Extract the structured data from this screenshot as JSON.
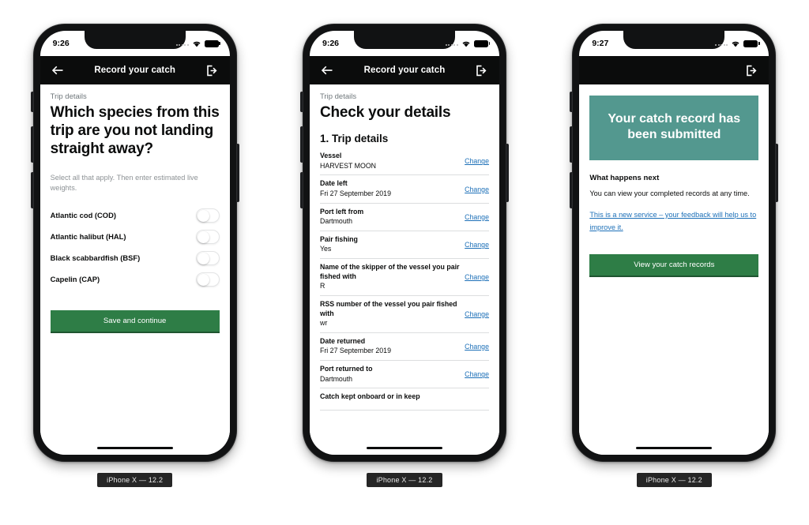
{
  "devices": [
    {
      "chip_label": "iPhone X — 12.2",
      "status": {
        "time": "9:26",
        "wifi_icon": "wifi-icon",
        "battery_icon": "battery-icon",
        "signal_icon": "signal-dots-icon"
      },
      "appbar": {
        "back_icon": "back-arrow-icon",
        "title": "Record your catch",
        "exit_icon": "sign-out-icon",
        "has_back": true,
        "has_title": true
      }
    },
    {
      "chip_label": "iPhone X — 12.2",
      "status": {
        "time": "9:26",
        "wifi_icon": "wifi-icon",
        "battery_icon": "battery-icon",
        "signal_icon": "signal-dots-icon"
      },
      "appbar": {
        "back_icon": "back-arrow-icon",
        "title": "Record your catch",
        "exit_icon": "sign-out-icon",
        "has_back": true,
        "has_title": true
      }
    },
    {
      "chip_label": "iPhone X — 12.2",
      "status": {
        "time": "9:27",
        "wifi_icon": "wifi-icon",
        "battery_icon": "battery-icon",
        "signal_icon": "signal-dots-icon"
      },
      "appbar": {
        "back_icon": "",
        "title": "",
        "exit_icon": "sign-out-icon",
        "has_back": false,
        "has_title": false
      }
    }
  ],
  "screen1": {
    "caption": "Trip details",
    "heading": "Which species from this trip are you not landing straight away?",
    "hint": "Select all that apply. Then enter estimated live weights.",
    "species": [
      {
        "label": "Atlantic cod (COD)",
        "state": "off"
      },
      {
        "label": "Atlantic halibut (HAL)",
        "state": "off"
      },
      {
        "label": "Black scabbardfish (BSF)",
        "state": "off"
      },
      {
        "label": "Capelin (CAP)",
        "state": "off"
      }
    ],
    "primary_button": "Save and continue"
  },
  "screen2": {
    "caption": "Trip details",
    "heading": "Check your details",
    "section_title": "1. Trip details",
    "change_label": "Change",
    "rows": [
      {
        "key": "Vessel",
        "value": "HARVEST MOON"
      },
      {
        "key": "Date left",
        "value": "Fri 27 September 2019"
      },
      {
        "key": "Port left from",
        "value": "Dartmouth"
      },
      {
        "key": "Pair fishing",
        "value": "Yes"
      },
      {
        "key": "Name of the skipper of the vessel you pair fished with",
        "value": "R"
      },
      {
        "key": "RSS number of the vessel you pair fished with",
        "value": "wr"
      },
      {
        "key": "Date returned",
        "value": "Fri 27 September 2019"
      },
      {
        "key": "Port returned to",
        "value": "Dartmouth"
      },
      {
        "key": "Catch kept onboard or in keep",
        "value": ""
      }
    ]
  },
  "screen3": {
    "panel_text": "Your catch record has been submitted",
    "sub_heading": "What happens next",
    "paragraph": "You can view your completed records at any time.",
    "feedback_link": "This is a new service – your feedback will help us to improve it.",
    "primary_button": "View your catch records"
  },
  "colors": {
    "brand_green": "#2e7d46",
    "panel_teal": "#53988f",
    "link_blue": "#1d70b8",
    "appbar_black": "#0b0c0c",
    "muted_grey": "#6f777b"
  }
}
